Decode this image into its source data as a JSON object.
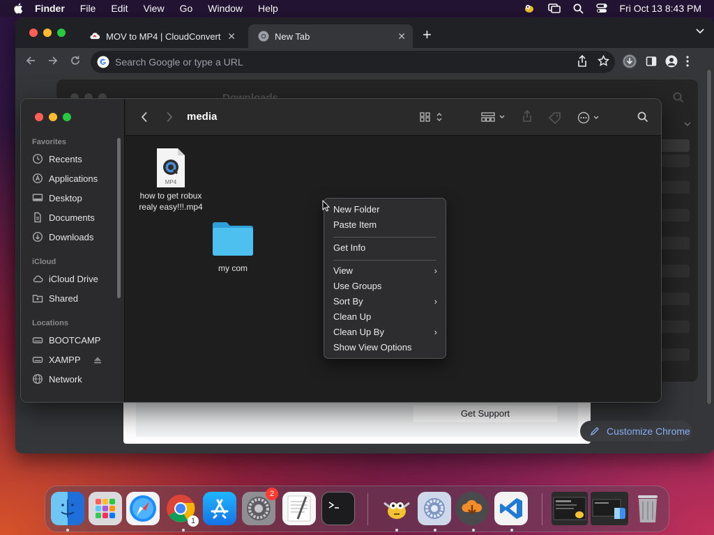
{
  "menubar": {
    "app": "Finder",
    "items": [
      "File",
      "Edit",
      "View",
      "Go",
      "Window",
      "Help"
    ],
    "datetime": "Fri Oct 13  8:43 PM"
  },
  "chrome": {
    "tabs": [
      {
        "title": "MOV to MP4 | CloudConvert",
        "icon": "cloudconvert-icon"
      },
      {
        "title": "New Tab",
        "icon": "chrome-icon"
      }
    ],
    "omnibox_placeholder": "Search Google or type a URL",
    "ntp": {
      "support_label": "Get Support",
      "customize_label": "Customize Chrome"
    }
  },
  "finder_back": {
    "title": "Downloads"
  },
  "finder": {
    "title": "media",
    "sidebar": {
      "favorites_header": "Favorites",
      "favorites": [
        "Recents",
        "Applications",
        "Desktop",
        "Documents",
        "Downloads"
      ],
      "icloud_header": "iCloud",
      "icloud": [
        "iCloud Drive",
        "Shared"
      ],
      "locations_header": "Locations",
      "locations": [
        "BOOTCAMP",
        "XAMPP",
        "Network"
      ]
    },
    "files": [
      {
        "name_line1": "how to get robux",
        "name_line2": "realy easy!!!.mp4",
        "badge": "MP4",
        "type": "video"
      },
      {
        "name_line1": "my com",
        "type": "folder"
      }
    ]
  },
  "context_menu": {
    "items": [
      "New Folder",
      "Paste Item",
      "Get Info",
      "View",
      "Use Groups",
      "Sort By",
      "Clean Up",
      "Clean Up By",
      "Show View Options"
    ]
  },
  "dock": {
    "apps": [
      "Finder",
      "Launchpad",
      "Safari",
      "Google Chrome",
      "App Store",
      "System Settings",
      "TextEdit",
      "Terminal",
      "Cyberduck",
      "Settings Utility",
      "Downloader",
      "Visual Studio Code",
      "Window Preview",
      "Finder Preview",
      "Trash"
    ],
    "settings_badge": "2"
  }
}
